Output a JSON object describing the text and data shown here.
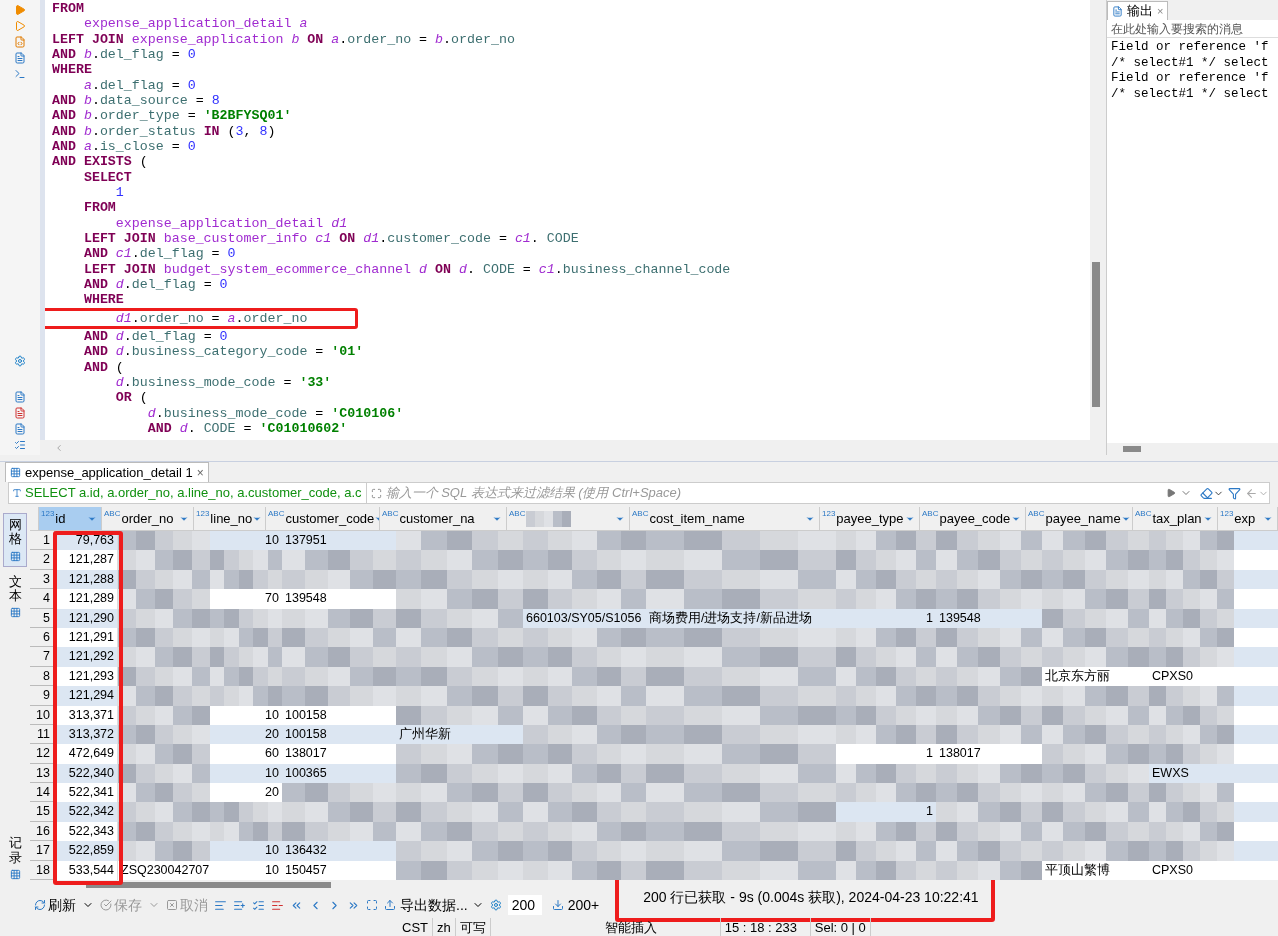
{
  "editor": {
    "lines": [
      {
        "tokens": [
          {
            "kind": "keyword",
            "text": "FROM"
          }
        ]
      },
      {
        "tokens": [
          {
            "kind": "table",
            "text": "    expense_application_detail "
          },
          {
            "kind": "alias",
            "text": "a"
          }
        ]
      },
      {
        "tokens": [
          {
            "kind": "keyword",
            "text": "LEFT JOIN "
          },
          {
            "kind": "table",
            "text": "expense_application "
          },
          {
            "kind": "alias",
            "text": "b "
          },
          {
            "kind": "keyword",
            "text": "ON "
          },
          {
            "kind": "alias",
            "text": "a"
          },
          {
            "kind": "plain",
            "text": "."
          },
          {
            "kind": "column",
            "text": "order_no"
          },
          {
            "kind": "plain",
            "text": " = "
          },
          {
            "kind": "alias",
            "text": "b"
          },
          {
            "kind": "plain",
            "text": "."
          },
          {
            "kind": "column",
            "text": "order_no"
          }
        ]
      },
      {
        "tokens": [
          {
            "kind": "keyword",
            "text": "AND "
          },
          {
            "kind": "alias",
            "text": "b"
          },
          {
            "kind": "plain",
            "text": "."
          },
          {
            "kind": "column",
            "text": "del_flag"
          },
          {
            "kind": "plain",
            "text": " = "
          },
          {
            "kind": "number",
            "text": "0"
          }
        ]
      },
      {
        "tokens": [
          {
            "kind": "keyword",
            "text": "WHERE"
          }
        ]
      },
      {
        "tokens": [
          {
            "kind": "alias",
            "text": "    a"
          },
          {
            "kind": "plain",
            "text": "."
          },
          {
            "kind": "column",
            "text": "del_flag"
          },
          {
            "kind": "plain",
            "text": " = "
          },
          {
            "kind": "number",
            "text": "0"
          }
        ]
      },
      {
        "tokens": [
          {
            "kind": "keyword",
            "text": "AND "
          },
          {
            "kind": "alias",
            "text": "b"
          },
          {
            "kind": "plain",
            "text": "."
          },
          {
            "kind": "column",
            "text": "data_source"
          },
          {
            "kind": "plain",
            "text": " = "
          },
          {
            "kind": "number",
            "text": "8"
          }
        ]
      },
      {
        "tokens": [
          {
            "kind": "keyword",
            "text": "AND "
          },
          {
            "kind": "alias",
            "text": "b"
          },
          {
            "kind": "plain",
            "text": "."
          },
          {
            "kind": "column",
            "text": "order_type"
          },
          {
            "kind": "plain",
            "text": " = "
          },
          {
            "kind": "string",
            "text": "'B2BFYSQ01'"
          }
        ]
      },
      {
        "tokens": [
          {
            "kind": "keyword",
            "text": "AND "
          },
          {
            "kind": "alias",
            "text": "b"
          },
          {
            "kind": "plain",
            "text": "."
          },
          {
            "kind": "column",
            "text": "order_status "
          },
          {
            "kind": "keyword",
            "text": "IN "
          },
          {
            "kind": "plain",
            "text": "("
          },
          {
            "kind": "number",
            "text": "3"
          },
          {
            "kind": "plain",
            "text": ", "
          },
          {
            "kind": "number",
            "text": "8"
          },
          {
            "kind": "plain",
            "text": ")"
          }
        ]
      },
      {
        "tokens": [
          {
            "kind": "keyword",
            "text": "AND "
          },
          {
            "kind": "alias",
            "text": "a"
          },
          {
            "kind": "plain",
            "text": "."
          },
          {
            "kind": "column",
            "text": "is_close"
          },
          {
            "kind": "plain",
            "text": " = "
          },
          {
            "kind": "number",
            "text": "0"
          }
        ]
      },
      {
        "tokens": [
          {
            "kind": "keyword",
            "text": "AND EXISTS "
          },
          {
            "kind": "plain",
            "text": "("
          }
        ]
      },
      {
        "tokens": [
          {
            "kind": "keyword",
            "text": "    SELECT"
          }
        ]
      },
      {
        "tokens": [
          {
            "kind": "number",
            "text": "        1"
          }
        ]
      },
      {
        "tokens": [
          {
            "kind": "keyword",
            "text": "    FROM"
          }
        ]
      },
      {
        "tokens": [
          {
            "kind": "table",
            "text": "        expense_application_detail "
          },
          {
            "kind": "alias",
            "text": "d1"
          }
        ]
      },
      {
        "tokens": [
          {
            "kind": "keyword",
            "text": "    LEFT JOIN "
          },
          {
            "kind": "table",
            "text": "base_customer_info "
          },
          {
            "kind": "alias",
            "text": "c1 "
          },
          {
            "kind": "keyword",
            "text": "ON "
          },
          {
            "kind": "alias",
            "text": "d1"
          },
          {
            "kind": "plain",
            "text": "."
          },
          {
            "kind": "column",
            "text": "customer_code"
          },
          {
            "kind": "plain",
            "text": " = "
          },
          {
            "kind": "alias",
            "text": "c1"
          },
          {
            "kind": "plain",
            "text": ". "
          },
          {
            "kind": "column",
            "text": "CODE"
          }
        ]
      },
      {
        "tokens": [
          {
            "kind": "keyword",
            "text": "    AND "
          },
          {
            "kind": "alias",
            "text": "c1"
          },
          {
            "kind": "plain",
            "text": "."
          },
          {
            "kind": "column",
            "text": "del_flag"
          },
          {
            "kind": "plain",
            "text": " = "
          },
          {
            "kind": "number",
            "text": "0"
          }
        ]
      },
      {
        "tokens": [
          {
            "kind": "keyword",
            "text": "    LEFT JOIN "
          },
          {
            "kind": "table",
            "text": "budget_system_ecommerce_channel "
          },
          {
            "kind": "alias",
            "text": "d "
          },
          {
            "kind": "keyword",
            "text": "ON "
          },
          {
            "kind": "alias",
            "text": "d"
          },
          {
            "kind": "plain",
            "text": ". "
          },
          {
            "kind": "column",
            "text": "CODE"
          },
          {
            "kind": "plain",
            "text": " = "
          },
          {
            "kind": "alias",
            "text": "c1"
          },
          {
            "kind": "plain",
            "text": "."
          },
          {
            "kind": "column",
            "text": "business_channel_code"
          }
        ]
      },
      {
        "tokens": [
          {
            "kind": "keyword",
            "text": "    AND "
          },
          {
            "kind": "alias",
            "text": "d"
          },
          {
            "kind": "plain",
            "text": "."
          },
          {
            "kind": "column",
            "text": "del_flag"
          },
          {
            "kind": "plain",
            "text": " = "
          },
          {
            "kind": "number",
            "text": "0"
          }
        ]
      },
      {
        "tokens": [
          {
            "kind": "keyword",
            "text": "    WHERE"
          }
        ]
      },
      {
        "highlighted": true,
        "tokens": [
          {
            "kind": "alias",
            "text": "        d1"
          },
          {
            "kind": "plain",
            "text": "."
          },
          {
            "kind": "column",
            "text": "order_no"
          },
          {
            "kind": "plain",
            "text": " = "
          },
          {
            "kind": "alias",
            "text": "a"
          },
          {
            "kind": "plain",
            "text": "."
          },
          {
            "kind": "column",
            "text": "order_no"
          }
        ]
      },
      {
        "tokens": [
          {
            "kind": "keyword",
            "text": "    AND "
          },
          {
            "kind": "alias",
            "text": "d"
          },
          {
            "kind": "plain",
            "text": "."
          },
          {
            "kind": "column",
            "text": "del_flag"
          },
          {
            "kind": "plain",
            "text": " = "
          },
          {
            "kind": "number",
            "text": "0"
          }
        ]
      },
      {
        "tokens": [
          {
            "kind": "keyword",
            "text": "    AND "
          },
          {
            "kind": "alias",
            "text": "d"
          },
          {
            "kind": "plain",
            "text": "."
          },
          {
            "kind": "column",
            "text": "business_category_code"
          },
          {
            "kind": "plain",
            "text": " = "
          },
          {
            "kind": "string",
            "text": "'01'"
          }
        ]
      },
      {
        "tokens": [
          {
            "kind": "keyword",
            "text": "    AND "
          },
          {
            "kind": "plain",
            "text": "("
          }
        ]
      },
      {
        "tokens": [
          {
            "kind": "alias",
            "text": "        d"
          },
          {
            "kind": "plain",
            "text": "."
          },
          {
            "kind": "column",
            "text": "business_mode_code"
          },
          {
            "kind": "plain",
            "text": " = "
          },
          {
            "kind": "string",
            "text": "'33'"
          }
        ]
      },
      {
        "tokens": [
          {
            "kind": "keyword",
            "text": "        OR "
          },
          {
            "kind": "plain",
            "text": "("
          }
        ]
      },
      {
        "tokens": [
          {
            "kind": "alias",
            "text": "            d"
          },
          {
            "kind": "plain",
            "text": "."
          },
          {
            "kind": "column",
            "text": "business_mode_code"
          },
          {
            "kind": "plain",
            "text": " = "
          },
          {
            "kind": "string",
            "text": "'C010106'"
          }
        ]
      },
      {
        "tokens": [
          {
            "kind": "keyword",
            "text": "            AND "
          },
          {
            "kind": "alias",
            "text": "d"
          },
          {
            "kind": "plain",
            "text": ". "
          },
          {
            "kind": "column",
            "text": "CODE"
          },
          {
            "kind": "plain",
            "text": " = "
          },
          {
            "kind": "string",
            "text": "'C01010602'"
          }
        ]
      }
    ]
  },
  "output": {
    "tab": "输出",
    "close": "×",
    "placeholder": "在此处输入要搜索的消息",
    "lines": [
      "Field or reference 'f",
      "/* select#1 */ select",
      "Field or reference 'f",
      "/* select#1 */ select"
    ]
  },
  "results": {
    "tab": "expense_application_detail 1",
    "close": "×",
    "query": "SELECT a.id, a.order_no, a.line_no, a.customer_code, a.c",
    "filter_placeholder": "输入一个 SQL 表达式来过滤结果 (使用 Ctrl+Space)",
    "side_tabs": [
      {
        "label": "网格",
        "selected": true
      },
      {
        "label": "文本",
        "selected": false
      },
      {
        "label": "记录",
        "selected": false
      }
    ],
    "columns": [
      {
        "label": "id",
        "type": "123",
        "selected": true,
        "highlighted": true
      },
      {
        "label": "order_no",
        "type": "ABC",
        "selected": false,
        "highlighted": false
      },
      {
        "label": "line_no",
        "type": "123",
        "selected": false,
        "highlighted": false
      },
      {
        "label": "customer_code",
        "type": "ABC",
        "selected": false,
        "highlighted": false
      },
      {
        "label": "customer_na",
        "type": "ABC",
        "selected": false,
        "highlighted": false
      },
      {
        "type": "ABC",
        "selected": false,
        "highlighted": false
      },
      {
        "label": "cost_item_name",
        "type": "ABC",
        "selected": false,
        "highlighted": false
      },
      {
        "label": "payee_type",
        "type": "123",
        "selected": false,
        "highlighted": false
      },
      {
        "label": "payee_code",
        "type": "ABC",
        "selected": false,
        "highlighted": false
      },
      {
        "label": "payee_name",
        "type": "ABC",
        "selected": false,
        "highlighted": false
      },
      {
        "label": "tax_plan",
        "type": "ABC",
        "selected": false,
        "highlighted": false
      },
      {
        "label": "exp",
        "type": "123",
        "selected": false,
        "highlighted": false
      }
    ],
    "rows": [
      {
        "n": "1",
        "cells": [
          "79,763",
          null,
          "10",
          "137951",
          null,
          null,
          null,
          null,
          null,
          null,
          null,
          null
        ]
      },
      {
        "n": "2",
        "cells": [
          "121,287",
          null,
          null,
          null,
          null,
          null,
          null,
          null,
          null,
          null,
          null,
          null
        ]
      },
      {
        "n": "3",
        "cells": [
          "121,288",
          null,
          null,
          null,
          null,
          null,
          null,
          null,
          null,
          null,
          null,
          null
        ]
      },
      {
        "n": "4",
        "cells": [
          "121,289",
          null,
          "70",
          "139548",
          null,
          null,
          null,
          null,
          null,
          null,
          null,
          null
        ]
      },
      {
        "n": "5",
        "cells": [
          "121,290",
          null,
          null,
          null,
          null,
          "660103/SY05/S1056",
          "商场费用/进场支持/新品进场",
          "1",
          "139548",
          null,
          null,
          null
        ]
      },
      {
        "n": "6",
        "cells": [
          "121,291",
          null,
          null,
          null,
          null,
          null,
          null,
          null,
          null,
          null,
          null,
          null
        ]
      },
      {
        "n": "7",
        "cells": [
          "121,292",
          null,
          null,
          null,
          null,
          null,
          null,
          null,
          null,
          null,
          null,
          null
        ]
      },
      {
        "n": "8",
        "cells": [
          "121,293",
          null,
          null,
          null,
          null,
          null,
          null,
          null,
          null,
          "北京东方丽",
          "CPXS0",
          null
        ]
      },
      {
        "n": "9",
        "cells": [
          "121,294",
          null,
          null,
          null,
          null,
          null,
          null,
          null,
          null,
          null,
          null,
          null
        ]
      },
      {
        "n": "10",
        "cells": [
          "313,371",
          null,
          "10",
          "100158",
          null,
          null,
          null,
          null,
          null,
          null,
          null,
          null
        ]
      },
      {
        "n": "11",
        "cells": [
          "313,372",
          null,
          "20",
          "100158",
          "广州华新",
          null,
          null,
          null,
          null,
          null,
          null,
          null
        ]
      },
      {
        "n": "12",
        "cells": [
          "472,649",
          null,
          "60",
          "138017",
          null,
          null,
          null,
          "1",
          "138017",
          null,
          null,
          null
        ]
      },
      {
        "n": "13",
        "cells": [
          "522,340",
          null,
          "10",
          "100365",
          null,
          null,
          null,
          null,
          null,
          null,
          "EWXS",
          null
        ]
      },
      {
        "n": "14",
        "cells": [
          "522,341",
          null,
          "20",
          null,
          null,
          null,
          null,
          null,
          null,
          null,
          null,
          null
        ]
      },
      {
        "n": "15",
        "cells": [
          "522,342",
          null,
          null,
          null,
          null,
          null,
          null,
          "1",
          null,
          null,
          null,
          null
        ]
      },
      {
        "n": "16",
        "cells": [
          "522,343",
          null,
          null,
          null,
          null,
          null,
          null,
          null,
          null,
          null,
          null,
          null
        ]
      },
      {
        "n": "17",
        "cells": [
          "522,859",
          null,
          "10",
          "136432",
          null,
          null,
          null,
          null,
          null,
          null,
          null,
          null
        ]
      },
      {
        "n": "18",
        "cells": [
          "533,544",
          "ZSQ230042707",
          "10",
          "150457",
          null,
          null,
          null,
          null,
          null,
          "平顶山繁博",
          "CPXS0",
          null
        ]
      }
    ]
  },
  "toolbar": {
    "buttons": [
      {
        "label": "刷新",
        "disabled": false
      },
      {
        "label": "保存",
        "disabled": true
      },
      {
        "label": "取消",
        "disabled": true
      }
    ],
    "export": "导出数据...",
    "fetch_size": "200",
    "fetch_more": "200+"
  },
  "status": {
    "text": "200 行已获取 - 9s (0.004s 获取), 2024-04-23 10:22:41",
    "highlighted": true
  },
  "status_bar": [
    "CST",
    "zh",
    "可写",
    "智能插入",
    "15 : 18 : 233",
    "Sel: 0 | 0"
  ]
}
